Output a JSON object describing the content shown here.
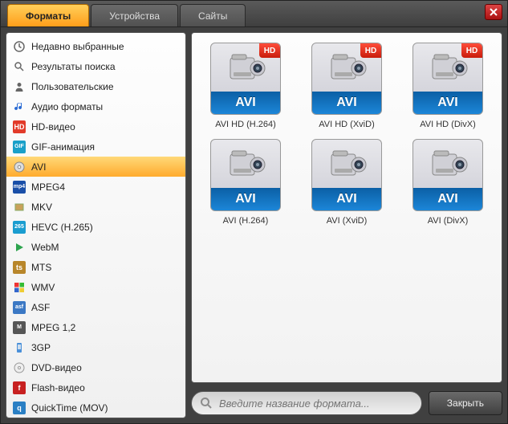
{
  "tabs": [
    {
      "label": "Форматы",
      "active": true
    },
    {
      "label": "Устройства",
      "active": false
    },
    {
      "label": "Сайты",
      "active": false
    }
  ],
  "sidebar": {
    "items": [
      {
        "label": "Недавно выбранные",
        "icon": "clock",
        "bg": "#888"
      },
      {
        "label": "Результаты поиска",
        "icon": "search",
        "bg": "#888"
      },
      {
        "label": "Пользовательские",
        "icon": "user",
        "bg": "#888"
      },
      {
        "label": "Аудио форматы",
        "icon": "note",
        "bg": "#2a6bd4"
      },
      {
        "label": "HD-видео",
        "icon": "HD",
        "bg": "#e23b2a"
      },
      {
        "label": "GIF-анимация",
        "icon": "GIF",
        "bg": "#1aa0c9"
      },
      {
        "label": "AVI",
        "icon": "disc",
        "bg": "#999",
        "selected": true
      },
      {
        "label": "MPEG4",
        "icon": "mp4",
        "bg": "#1a4fa8"
      },
      {
        "label": "MKV",
        "icon": "box",
        "bg": "#6a8"
      },
      {
        "label": "HEVC (H.265)",
        "icon": "265",
        "bg": "#1a9dd0"
      },
      {
        "label": "WebM",
        "icon": "play",
        "bg": "#2da44e"
      },
      {
        "label": "MTS",
        "icon": "ts",
        "bg": "#b8862a"
      },
      {
        "label": "WMV",
        "icon": "flag",
        "bg": "#3b78c4"
      },
      {
        "label": "ASF",
        "icon": "asf",
        "bg": "#3b78c4"
      },
      {
        "label": "MPEG 1,2",
        "icon": "mpeg",
        "bg": "#555"
      },
      {
        "label": "3GP",
        "icon": "phone",
        "bg": "#4a90d9"
      },
      {
        "label": "DVD-видео",
        "icon": "dvd",
        "bg": "#999"
      },
      {
        "label": "Flash-видео",
        "icon": "f",
        "bg": "#c72020"
      },
      {
        "label": "QuickTime (MOV)",
        "icon": "q",
        "bg": "#2a7fc4"
      }
    ]
  },
  "presets": [
    {
      "name": "AVI HD (H.264)",
      "badge": "HD",
      "fmt": "AVI"
    },
    {
      "name": "AVI HD (XviD)",
      "badge": "HD",
      "fmt": "AVI"
    },
    {
      "name": "AVI HD (DivX)",
      "badge": "HD",
      "fmt": "AVI"
    },
    {
      "name": "AVI (H.264)",
      "badge": "",
      "fmt": "AVI"
    },
    {
      "name": "AVI (XviD)",
      "badge": "",
      "fmt": "AVI"
    },
    {
      "name": "AVI (DivX)",
      "badge": "",
      "fmt": "AVI"
    }
  ],
  "search": {
    "placeholder": "Введите название формата..."
  },
  "footer": {
    "close_label": "Закрыть"
  }
}
